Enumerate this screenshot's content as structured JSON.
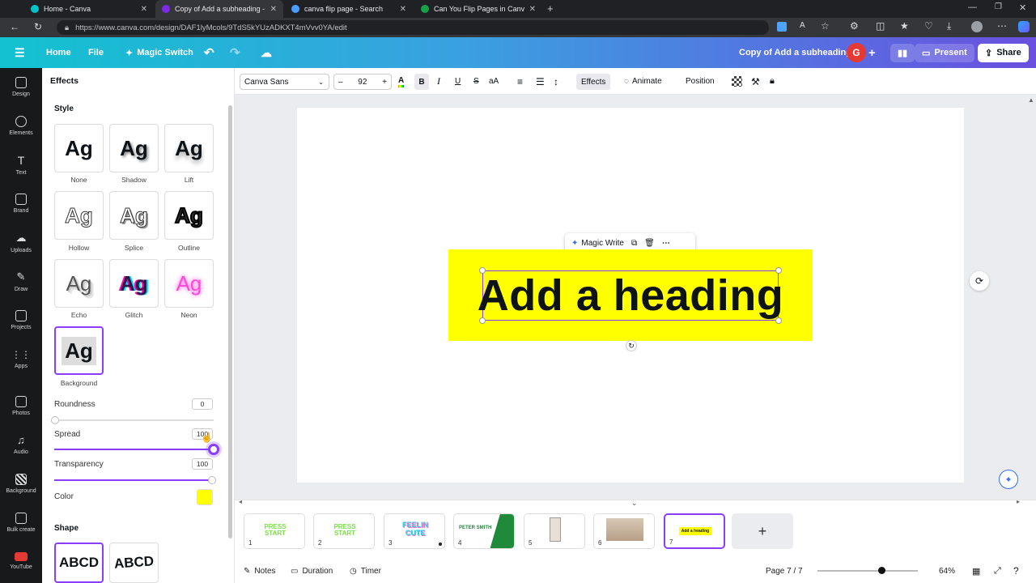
{
  "browser": {
    "tabs": [
      {
        "title": "Home - Canva",
        "color": "#00c4cc"
      },
      {
        "title": "Copy of Add a subheading - Pre",
        "color": "#7d2ae8"
      },
      {
        "title": "canva flip page - Search",
        "color": "#4a9dff"
      },
      {
        "title": "Can You Flip Pages in Canva? | W",
        "color": "#16a34a"
      }
    ],
    "url": "https://www.canva.com/design/DAF1lyMcols/9TdS5kYUzADKXT4mVvv0YA/edit"
  },
  "header": {
    "home": "Home",
    "file": "File",
    "magic_switch": "Magic Switch",
    "doc_title": "Copy of Add a subheading",
    "avatar": "G",
    "present": "Present",
    "share": "Share"
  },
  "rail": [
    "Design",
    "Elements",
    "Text",
    "Brand",
    "Uploads",
    "Draw",
    "Projects",
    "Apps",
    "Photos",
    "Audio",
    "Background",
    "Bulk create",
    "YouTube"
  ],
  "panel": {
    "title": "Effects",
    "style_heading": "Style",
    "tile_glyph": "Ag",
    "styles": [
      "None",
      "Shadow",
      "Lift",
      "Hollow",
      "Splice",
      "Outline",
      "Echo",
      "Glitch",
      "Neon",
      "Background"
    ],
    "selected_style": "Background",
    "roundness_label": "Roundness",
    "roundness_value": "0",
    "spread_label": "Spread",
    "spread_value": "100",
    "transparency_label": "Transparency",
    "transparency_value": "100",
    "color_label": "Color",
    "color_value": "#ffff00",
    "shape_heading": "Shape",
    "shape_glyph": "ABCD"
  },
  "toolbar": {
    "font": "Canva Sans",
    "size": "92",
    "effects": "Effects",
    "animate": "Animate",
    "position": "Position"
  },
  "canvas": {
    "heading_text": "Add a heading",
    "magic_write": "Magic Write"
  },
  "pages": [
    {
      "n": "1",
      "text": "PRESS START",
      "kind": "green-text"
    },
    {
      "n": "2",
      "text": "PRESS START",
      "kind": "green-text"
    },
    {
      "n": "3",
      "text": "FEELIN CUTE",
      "kind": "pink-text"
    },
    {
      "n": "4",
      "text": "PETER SMITH",
      "kind": "card"
    },
    {
      "n": "5",
      "text": "",
      "kind": "photo"
    },
    {
      "n": "6",
      "text": "",
      "kind": "photo2"
    },
    {
      "n": "7",
      "text": "Add a heading",
      "kind": "current"
    }
  ],
  "bottom": {
    "notes": "Notes",
    "duration": "Duration",
    "timer": "Timer",
    "page_indicator": "Page 7 / 7",
    "zoom": "64%",
    "zoom_fraction": 0.64
  }
}
